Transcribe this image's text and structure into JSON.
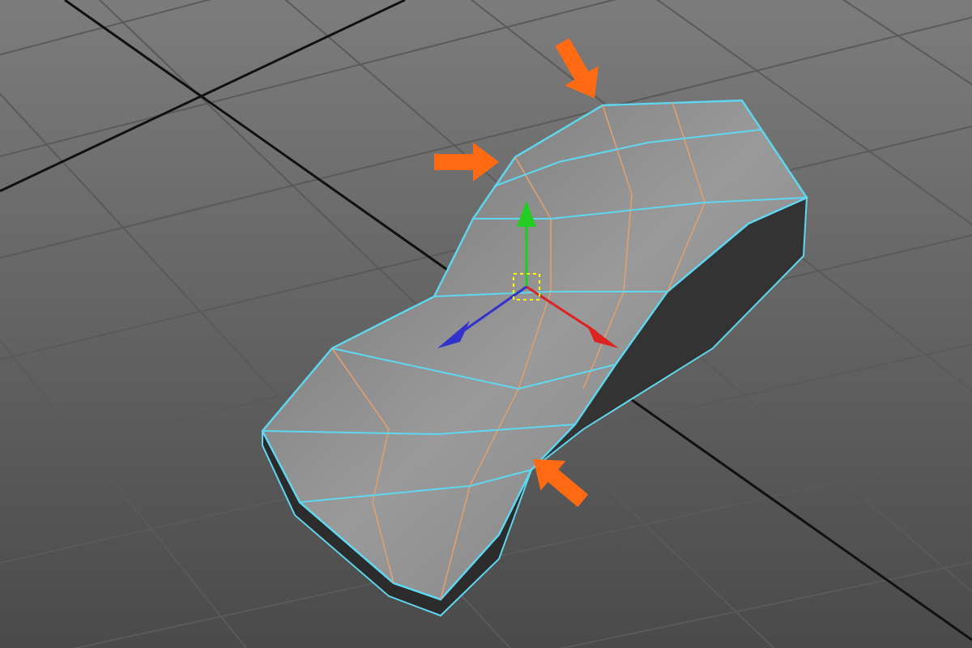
{
  "viewport": {
    "grid_visible": true,
    "move_manipulator_visible": true,
    "callout_arrows_visible": true
  }
}
